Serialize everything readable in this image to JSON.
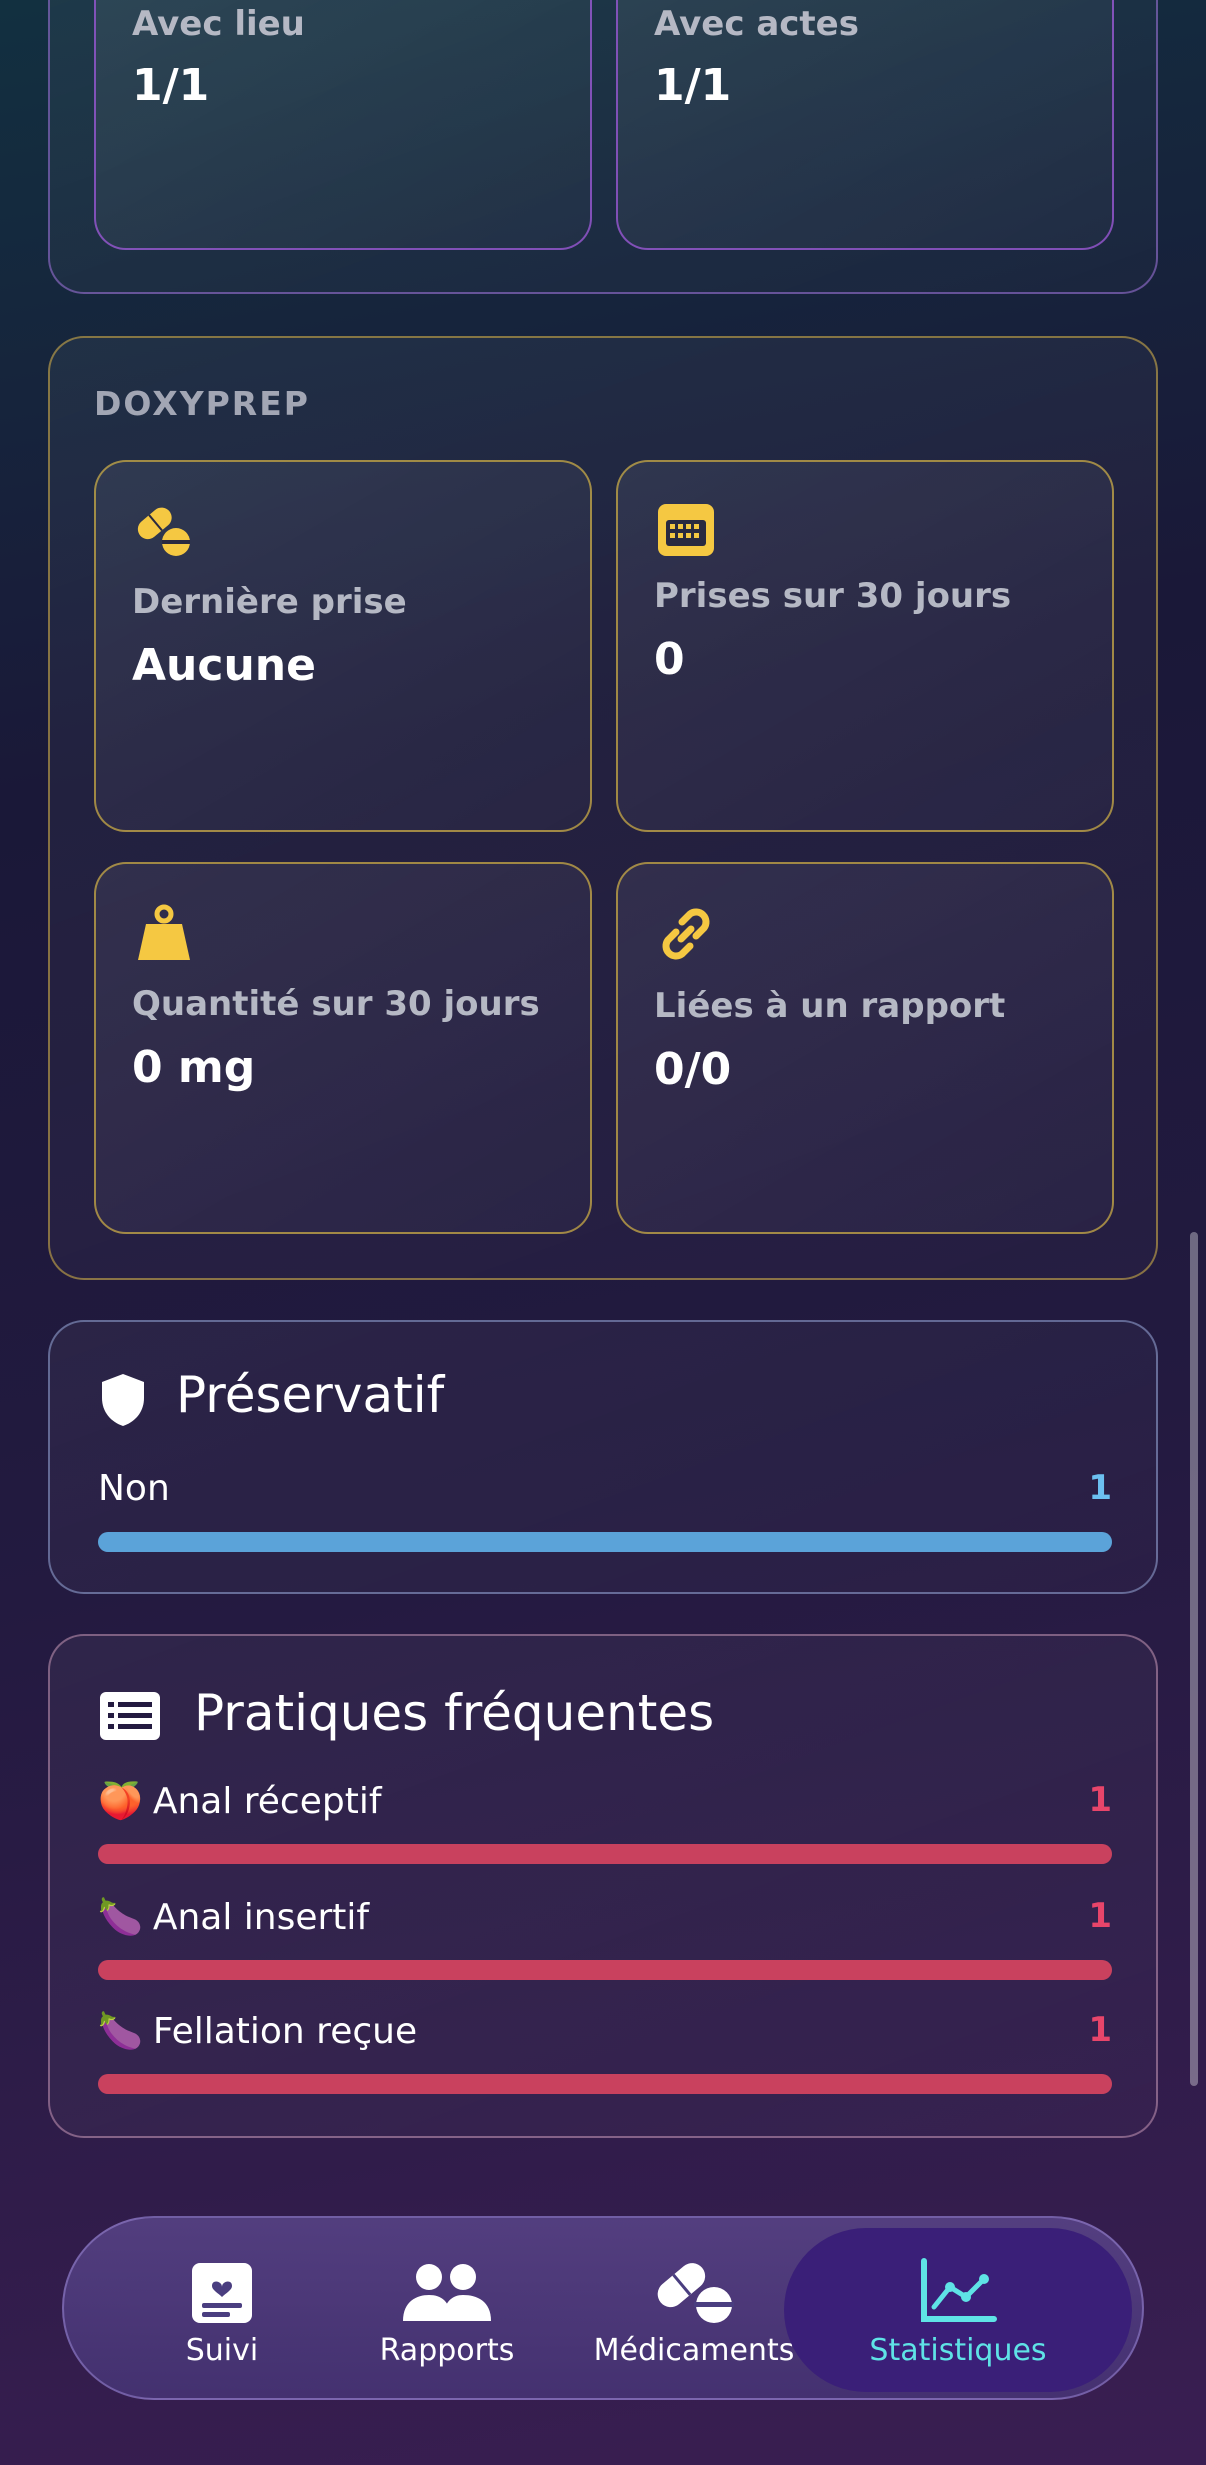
{
  "top_section": {
    "cards": [
      {
        "label": "Avec lieu",
        "value": "1/1"
      },
      {
        "label": "Avec actes",
        "value": "1/1"
      }
    ]
  },
  "doxyprep": {
    "section_label": "DOXYPREP",
    "accent_color": "#f5c842",
    "cards": [
      {
        "icon": "pills-icon",
        "label": "Dernière prise",
        "value": "Aucune"
      },
      {
        "icon": "calendar-icon",
        "label": "Prises sur 30 jours",
        "value": "0"
      },
      {
        "icon": "weight-icon",
        "label": "Quantité sur 30 jours",
        "value": "0 mg"
      },
      {
        "icon": "link-icon",
        "label": "Liées à un rapport",
        "value": "0/0"
      }
    ]
  },
  "preservatif": {
    "title": "Préservatif",
    "icon": "shield-icon",
    "bar_color": "#5ba3d9",
    "count_color": "#6cc0f0",
    "rows": [
      {
        "label": "Non",
        "count": "1",
        "fraction": 1.0
      }
    ]
  },
  "pratiques": {
    "title": "Pratiques fréquentes",
    "icon": "list-icon",
    "bar_color": "#c9415e",
    "count_color": "#e8456a",
    "rows": [
      {
        "emoji": "🍑",
        "label": "Anal réceptif",
        "count": "1",
        "fraction": 1.0
      },
      {
        "emoji": "🍆",
        "label": "Anal insertif",
        "count": "1",
        "fraction": 1.0
      },
      {
        "emoji": "🍆",
        "label": "Fellation reçue",
        "count": "1",
        "fraction": 1.0
      }
    ]
  },
  "nav": {
    "items": [
      {
        "icon": "journal-icon",
        "label": "Suivi",
        "active": false
      },
      {
        "icon": "users-icon",
        "label": "Rapports",
        "active": false
      },
      {
        "icon": "pills-icon",
        "label": "Médicaments",
        "active": false
      },
      {
        "icon": "chart-line-icon",
        "label": "Statistiques",
        "active": true
      }
    ],
    "active_color": "#5fe3e6"
  }
}
